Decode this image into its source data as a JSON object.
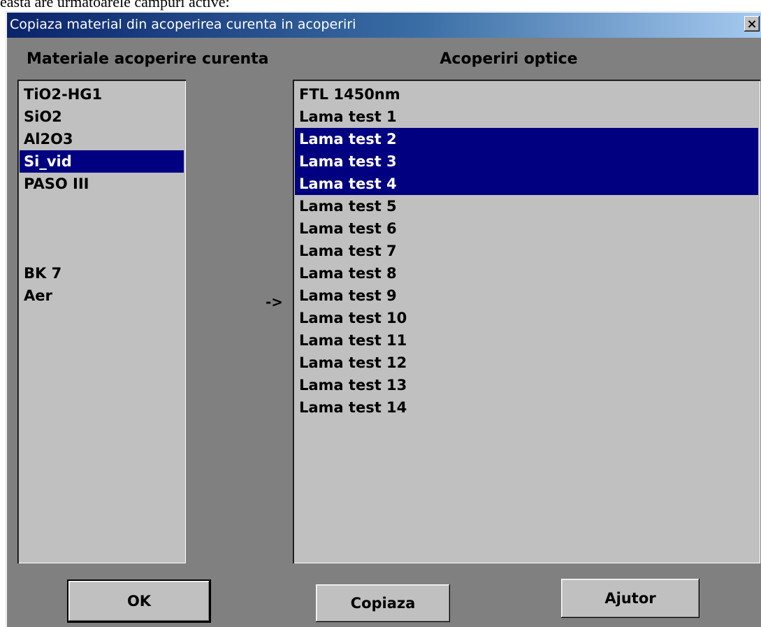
{
  "doc": {
    "above_text": "easta are urmatoarele campuri active:"
  },
  "window": {
    "title": "Copiaza material din acoperirea curenta in acoperiri",
    "close_symbol": "×"
  },
  "left_panel": {
    "label": "Materiale acoperire curenta",
    "items": [
      {
        "label": "TiO2-HG1",
        "selected": false
      },
      {
        "label": "SiO2",
        "selected": false
      },
      {
        "label": "Al2O3",
        "selected": false
      },
      {
        "label": "Si_vid",
        "selected": true
      },
      {
        "label": "PASO III",
        "selected": false
      },
      {
        "label": "",
        "selected": false
      },
      {
        "label": "",
        "selected": false
      },
      {
        "label": "",
        "selected": false
      },
      {
        "label": "BK 7",
        "selected": false
      },
      {
        "label": "Aer",
        "selected": false
      }
    ]
  },
  "arrow": "->",
  "right_panel": {
    "label": "Acoperiri optice",
    "items": [
      {
        "label": "FTL 1450nm",
        "selected": false
      },
      {
        "label": "Lama test 1",
        "selected": false
      },
      {
        "label": "Lama test 2",
        "selected": true
      },
      {
        "label": "Lama test 3",
        "selected": true
      },
      {
        "label": "Lama test 4",
        "selected": true
      },
      {
        "label": "Lama test 5",
        "selected": false
      },
      {
        "label": "Lama test 6",
        "selected": false
      },
      {
        "label": "Lama test 7",
        "selected": false
      },
      {
        "label": "Lama test 8",
        "selected": false
      },
      {
        "label": "Lama test 9",
        "selected": false
      },
      {
        "label": "Lama test 10",
        "selected": false
      },
      {
        "label": "Lama test 11",
        "selected": false
      },
      {
        "label": "Lama test 12",
        "selected": false
      },
      {
        "label": "Lama test 13",
        "selected": false
      },
      {
        "label": "Lama test 14",
        "selected": false
      }
    ]
  },
  "buttons": {
    "ok": "OK",
    "copy": "Copiaza",
    "help": "Ajutor"
  },
  "colors": {
    "selection": "#000080",
    "face": "#c0c0c0",
    "dialog_bg": "#808080",
    "title_start": "#0a246a"
  }
}
